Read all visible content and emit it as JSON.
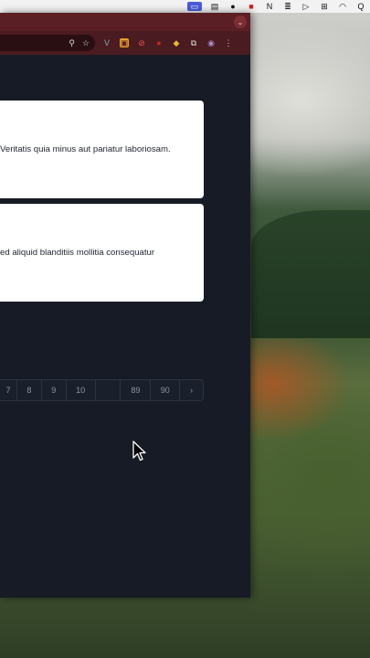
{
  "menubar": {
    "icons": [
      "stage-manager-icon",
      "screen-icon",
      "circle-c-icon",
      "record-icon",
      "n-icon",
      "database-icon",
      "play-icon",
      "grid-icon",
      "wifi-icon",
      "search-icon"
    ],
    "glyphs": [
      "▭",
      "▤",
      "●",
      "■",
      "N",
      "≣",
      "▷",
      "⊞",
      "◠",
      "Q"
    ]
  },
  "browser": {
    "collapse_glyph": "⌄",
    "address_icons": [
      "zoom-icon",
      "star-icon"
    ],
    "address_glyphs": [
      "⚲",
      "☆"
    ],
    "extensions": [
      "vue-devtools-icon",
      "extension-icon",
      "block-icon",
      "record-icon",
      "colorful-icon",
      "puzzle-icon",
      "profile-icon",
      "menu-icon"
    ],
    "extension_glyphs": [
      "V",
      "▣",
      "⊘",
      "●",
      "◆",
      "⧉",
      "◉",
      "⋮"
    ]
  },
  "cards": [
    {
      "text": "Veritatis quia minus aut pariatur laboriosam."
    },
    {
      "text": "ed aliquid blanditiis mollitia consequatur"
    }
  ],
  "pagination": {
    "items": [
      "7",
      "8",
      "9",
      "10",
      "",
      "89",
      "90",
      "›"
    ]
  }
}
